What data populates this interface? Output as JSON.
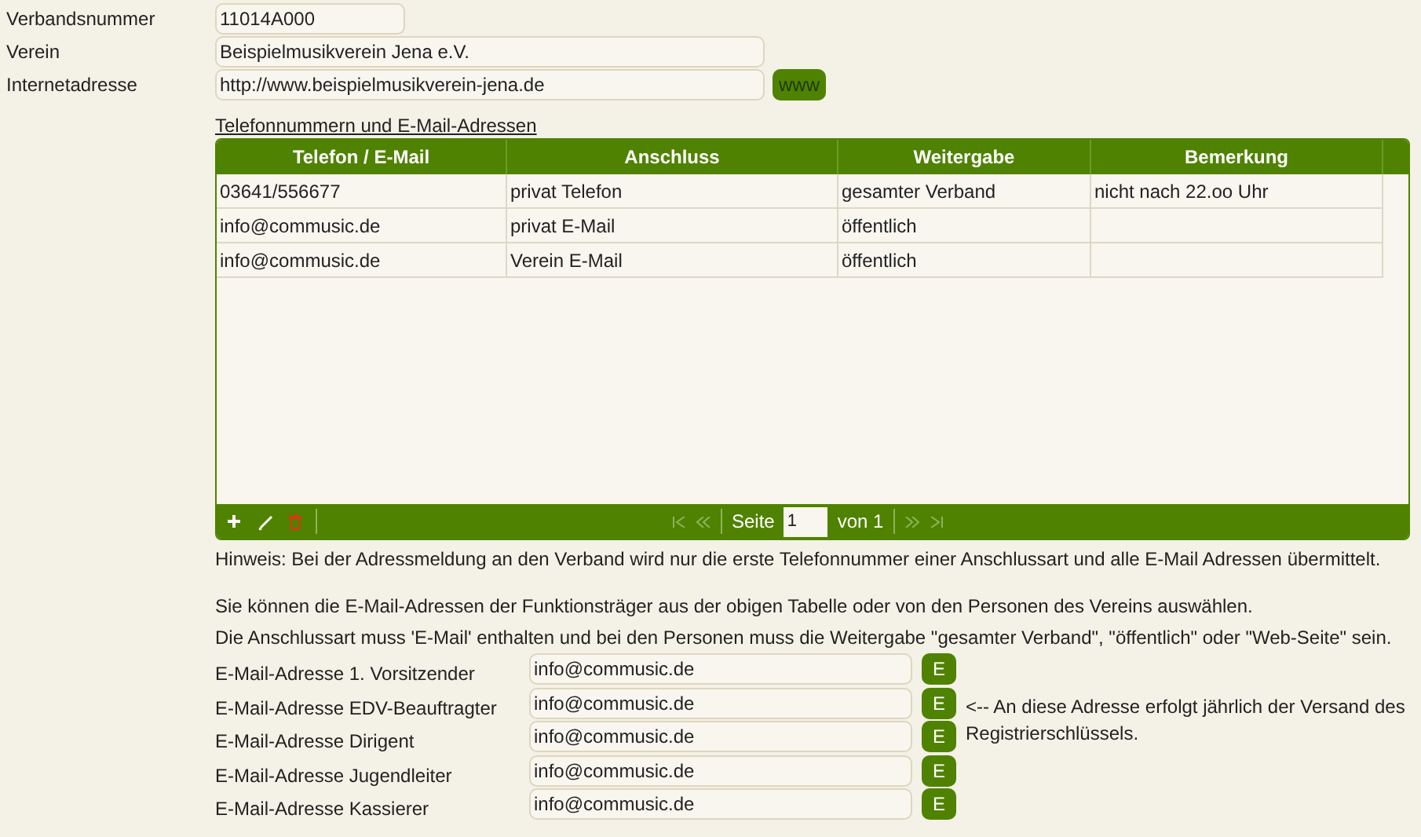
{
  "fields": [
    {
      "label": "Verbandsnummer",
      "value": "11014A000",
      "kind": "short"
    },
    {
      "label": "Verein",
      "value": "Beispielmusikverein Jena e.V.",
      "kind": "long"
    },
    {
      "label": "Internetadresse",
      "value": "http://www.beispielmusikverein-jena.de",
      "kind": "link",
      "button": "www"
    }
  ],
  "table": {
    "title": "Telefonnummern und E-Mail-Adressen",
    "columns": [
      "Telefon / E-Mail",
      "Anschluss",
      "Weitergabe",
      "Bemerkung"
    ],
    "rows": [
      [
        "03641/556677",
        "privat Telefon",
        "gesamter Verband",
        "nicht nach 22.oo Uhr"
      ],
      [
        "info@commusic.de",
        "privat E-Mail",
        "öffentlich",
        ""
      ],
      [
        "info@commusic.de",
        "Verein E-Mail",
        "öffentlich",
        ""
      ]
    ],
    "pager": {
      "page_label": "Seite",
      "page": "1",
      "of_label": "von 1"
    }
  },
  "hint": "Hinweis: Bei der Adressmeldung an den Verband wird nur die erste Telefonnummer einer Anschlussart und alle E-Mail Adressen übermittelt.",
  "info": [
    "Sie können die E-Mail-Adressen der Funktionsträger aus der obigen Tabelle oder von den Personen des Vereins auswählen.",
    "Die Anschlussart muss 'E-Mail' enthalten und bei den Personen muss die Weitergabe \"gesamter Verband\", \"öffentlich\" oder \"Web-Seite\" sein."
  ],
  "emails": [
    {
      "label": "E-Mail-Adresse 1. Vorsitzender",
      "value": "info@commusic.de",
      "button": "E"
    },
    {
      "label": "E-Mail-Adresse EDV-Beauftragter",
      "value": "info@commusic.de",
      "button": "E"
    },
    {
      "label": "E-Mail-Adresse Dirigent",
      "value": "info@commusic.de",
      "button": "E"
    },
    {
      "label": "E-Mail-Adresse Jugendleiter",
      "value": "info@commusic.de",
      "button": "E"
    },
    {
      "label": "E-Mail-Adresse Kassierer",
      "value": "info@commusic.de",
      "button": "E"
    }
  ],
  "email_note": "<-- An diese Adresse erfolgt jährlich der Versand des Registrierschlüssels."
}
